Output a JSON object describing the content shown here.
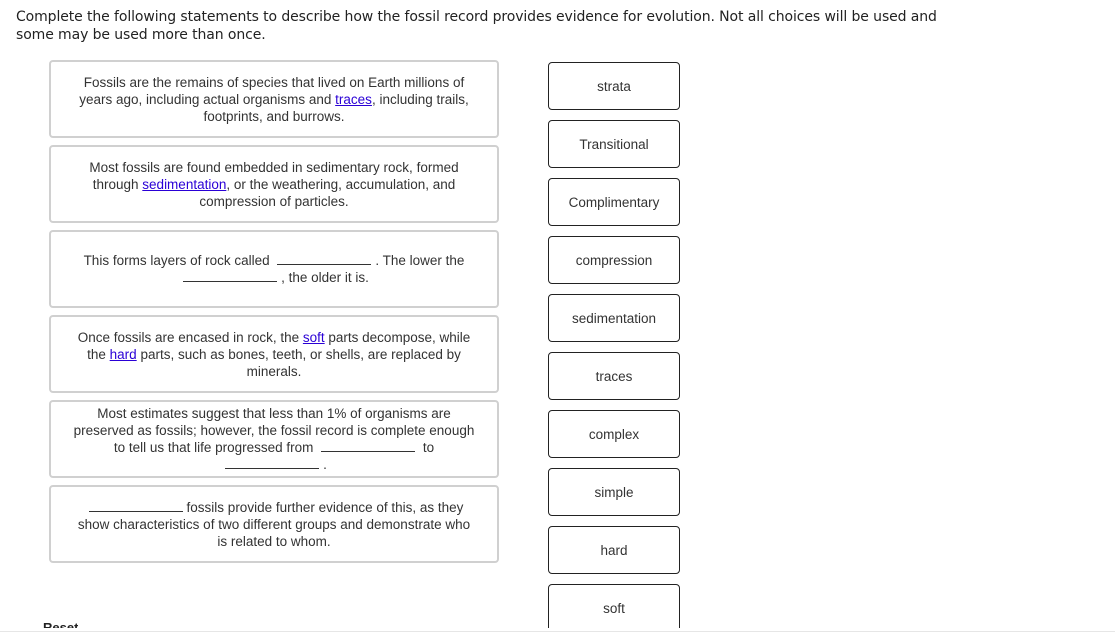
{
  "instructions": "Complete the following statements to describe how the fossil record provides evidence for evolution. Not all choices will be used and some may be used more than once.",
  "statements": [
    {
      "parts": [
        "Fossils are the remains of species that lived on Earth millions of years ago, including actual organisms and ",
        "traces",
        ", including trails, footprints, and burrows."
      ]
    },
    {
      "parts": [
        "Most fossils are found embedded in sedimentary rock, formed through ",
        "sedimentation",
        ", or the weathering, accumulation, and compression of particles."
      ]
    },
    {
      "parts": [
        "This forms layers of rock called ",
        ". The lower the ",
        ", the older it is."
      ]
    },
    {
      "parts": [
        "Once fossils are encased in rock, the ",
        "soft",
        " parts decompose, while the ",
        "hard",
        " parts, such as bones, teeth, or shells, are replaced by minerals."
      ]
    },
    {
      "parts": [
        "Most estimates suggest that less than 1% of organisms are preserved as fossils; however, the fossil record is complete enough to tell us that life progressed from ",
        " to ",
        "."
      ]
    },
    {
      "parts": [
        "fossils provide further evidence of this, as they show characteristics of two different groups and demonstrate who is related to whom."
      ]
    }
  ],
  "word_bank": [
    "strata",
    "Transitional",
    "Complimentary",
    "compression",
    "sedimentation",
    "traces",
    "complex",
    "simple",
    "hard",
    "soft"
  ],
  "reset_label": "Reset",
  "colors": {
    "link": "#2a00d6",
    "statement_border": "#d0d0d0",
    "word_border": "#222222"
  }
}
